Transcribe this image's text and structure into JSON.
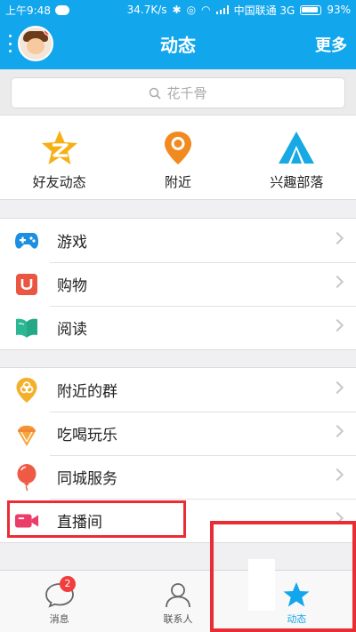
{
  "status_bar": {
    "time": "上午9:48",
    "speed": "34.7K/s",
    "carrier": "中国联通 3G",
    "battery": "93%"
  },
  "header": {
    "title": "动态",
    "more_label": "更多"
  },
  "search": {
    "placeholder": "花千骨"
  },
  "quick_items": [
    {
      "label": "好友动态",
      "icon": "qzone-star-icon"
    },
    {
      "label": "附近",
      "icon": "location-pin-icon"
    },
    {
      "label": "兴趣部落",
      "icon": "tent-icon"
    }
  ],
  "group1": [
    {
      "label": "游戏",
      "icon": "gamepad-icon"
    },
    {
      "label": "购物",
      "icon": "shopping-bag-icon"
    },
    {
      "label": "阅读",
      "icon": "book-icon"
    }
  ],
  "group2": [
    {
      "label": "附近的群",
      "icon": "group-pin-icon"
    },
    {
      "label": "吃喝玩乐",
      "icon": "icecream-icon"
    },
    {
      "label": "同城服务",
      "icon": "balloon-icon"
    },
    {
      "label": "直播间",
      "icon": "video-camera-icon"
    }
  ],
  "tabs": [
    {
      "label": "消息",
      "badge": "2",
      "icon": "chat-bubble-icon"
    },
    {
      "label": "联系人",
      "icon": "contacts-person-icon"
    },
    {
      "label": "动态",
      "icon": "star-icon",
      "active": true
    }
  ],
  "colors": {
    "accent": "#12a6ec",
    "highlight": "#ea2c35"
  }
}
